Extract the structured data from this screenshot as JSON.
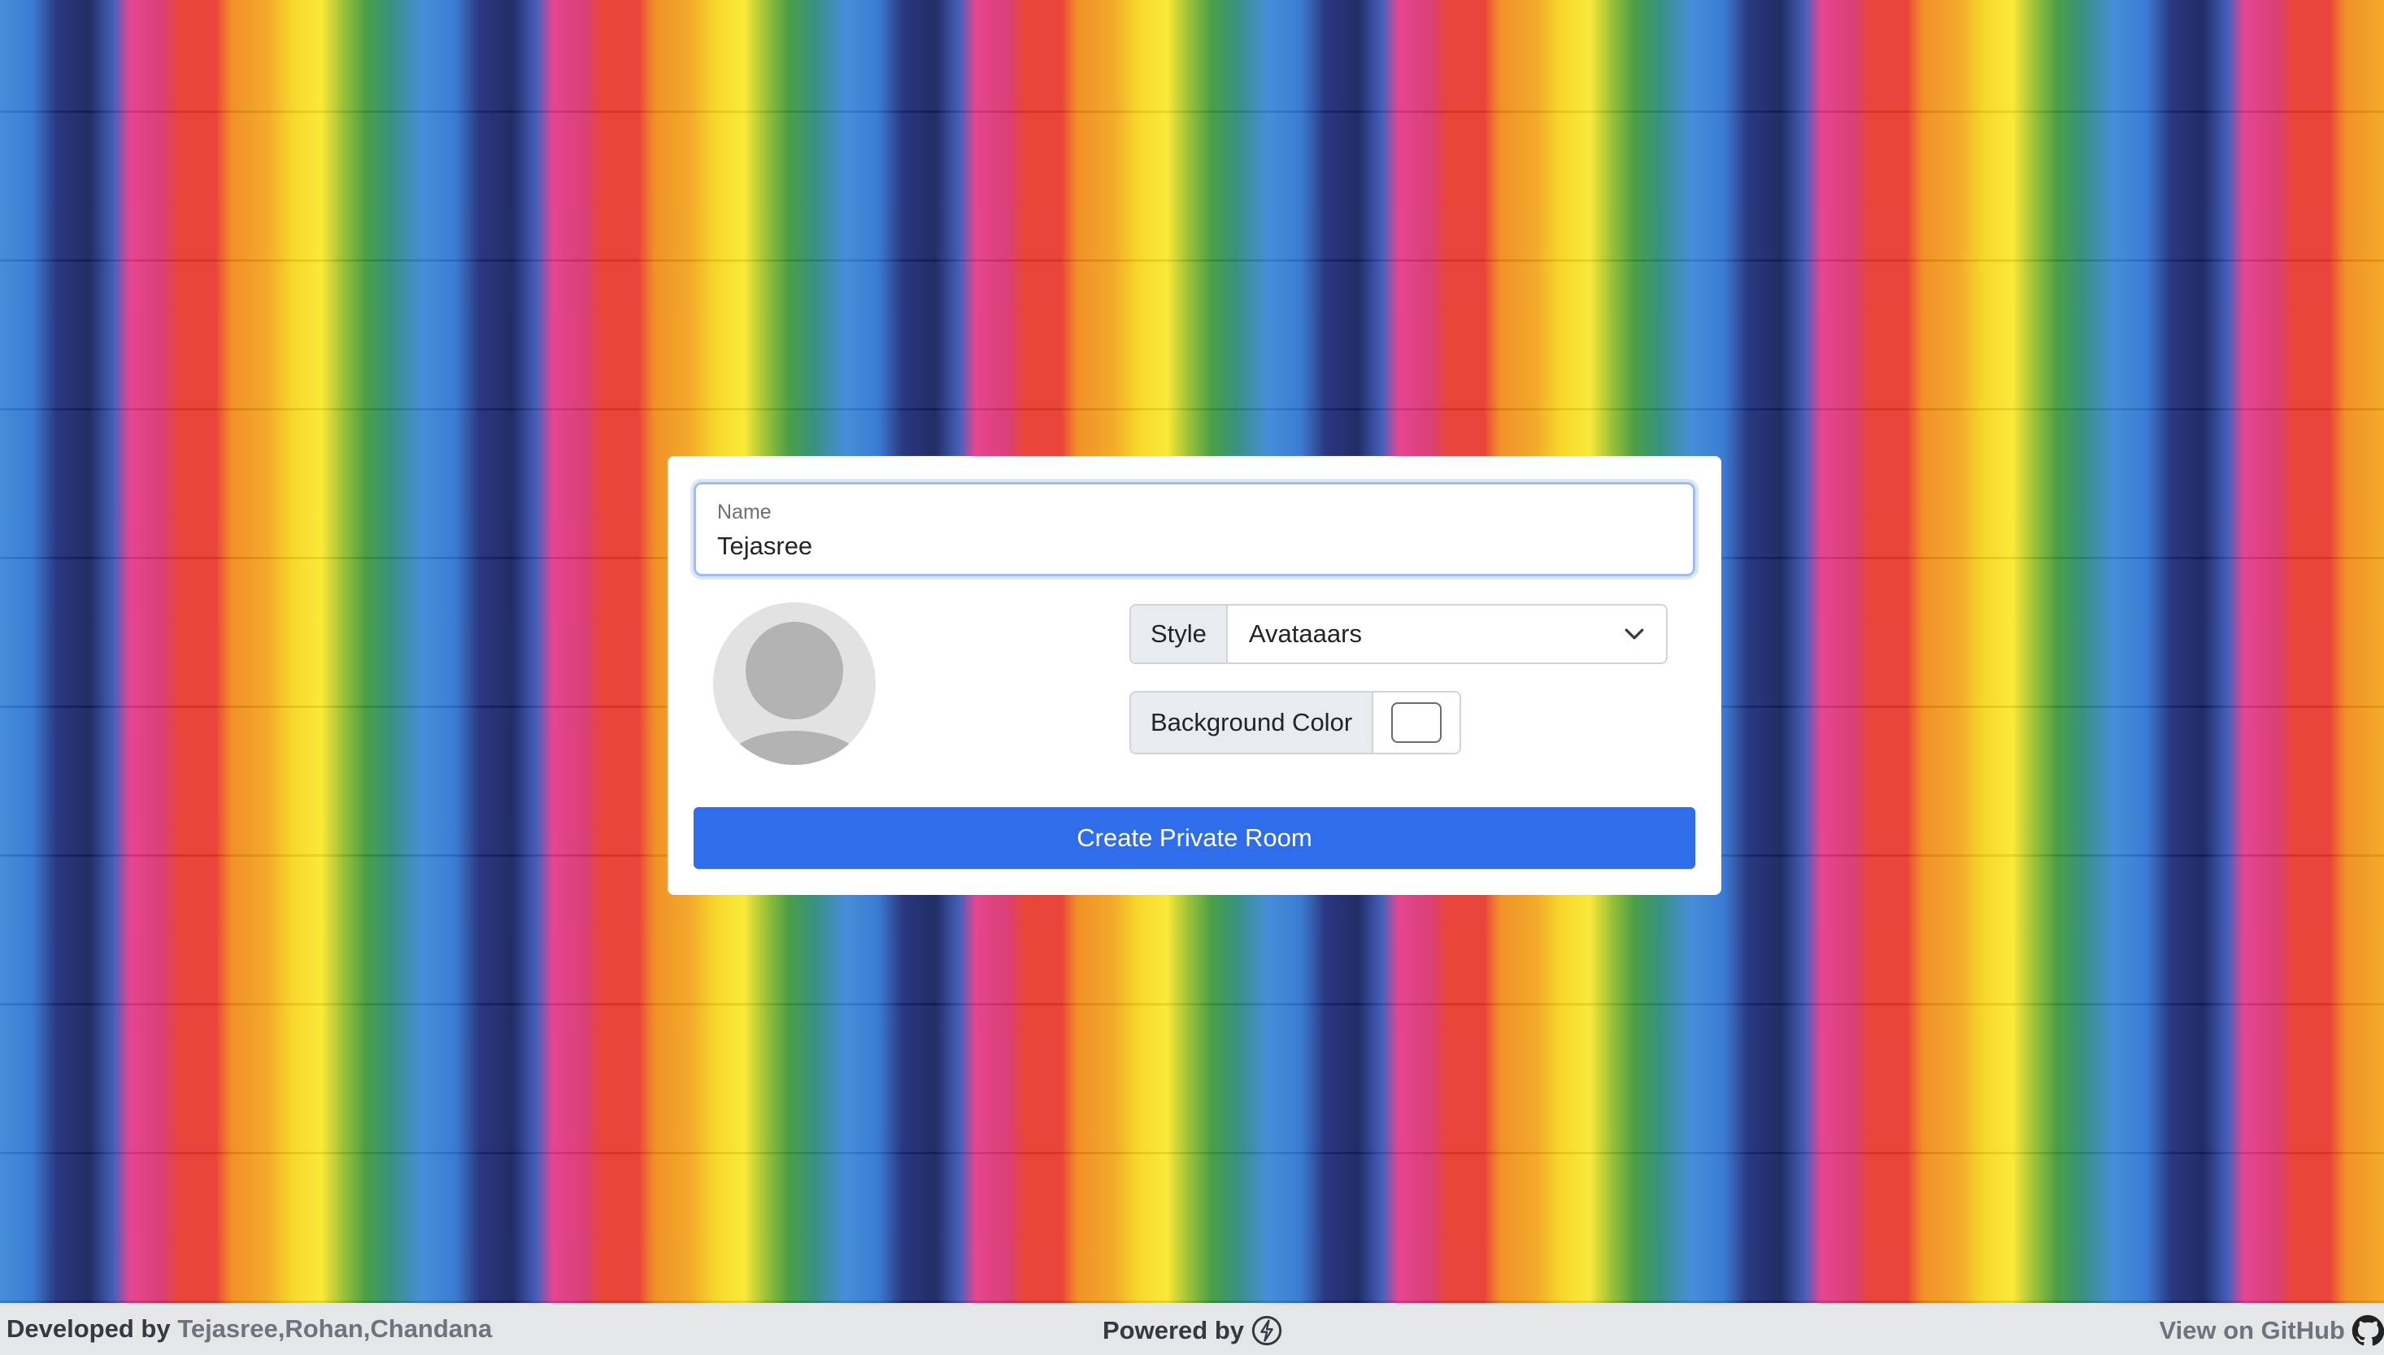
{
  "form": {
    "name_label": "Name",
    "name_value": "Tejasree",
    "style_label": "Style",
    "style_value": "Avataaars",
    "bg_color_label": "Background Color",
    "bg_color_value": "#ffffff",
    "create_button": "Create Private Room"
  },
  "footer": {
    "developed_prefix": "Developed by",
    "developers": "Tejasree,Rohan,Chandana",
    "powered_by": "Powered by",
    "view_github": "View on GitHub"
  },
  "icons": {
    "avatar": "default-avatar-icon",
    "select": "chevron-down-icon",
    "powered": "bolt-icon",
    "github": "github-icon"
  },
  "colors": {
    "primary": "#2f6deb",
    "footer_bg": "#e4e6e8"
  }
}
